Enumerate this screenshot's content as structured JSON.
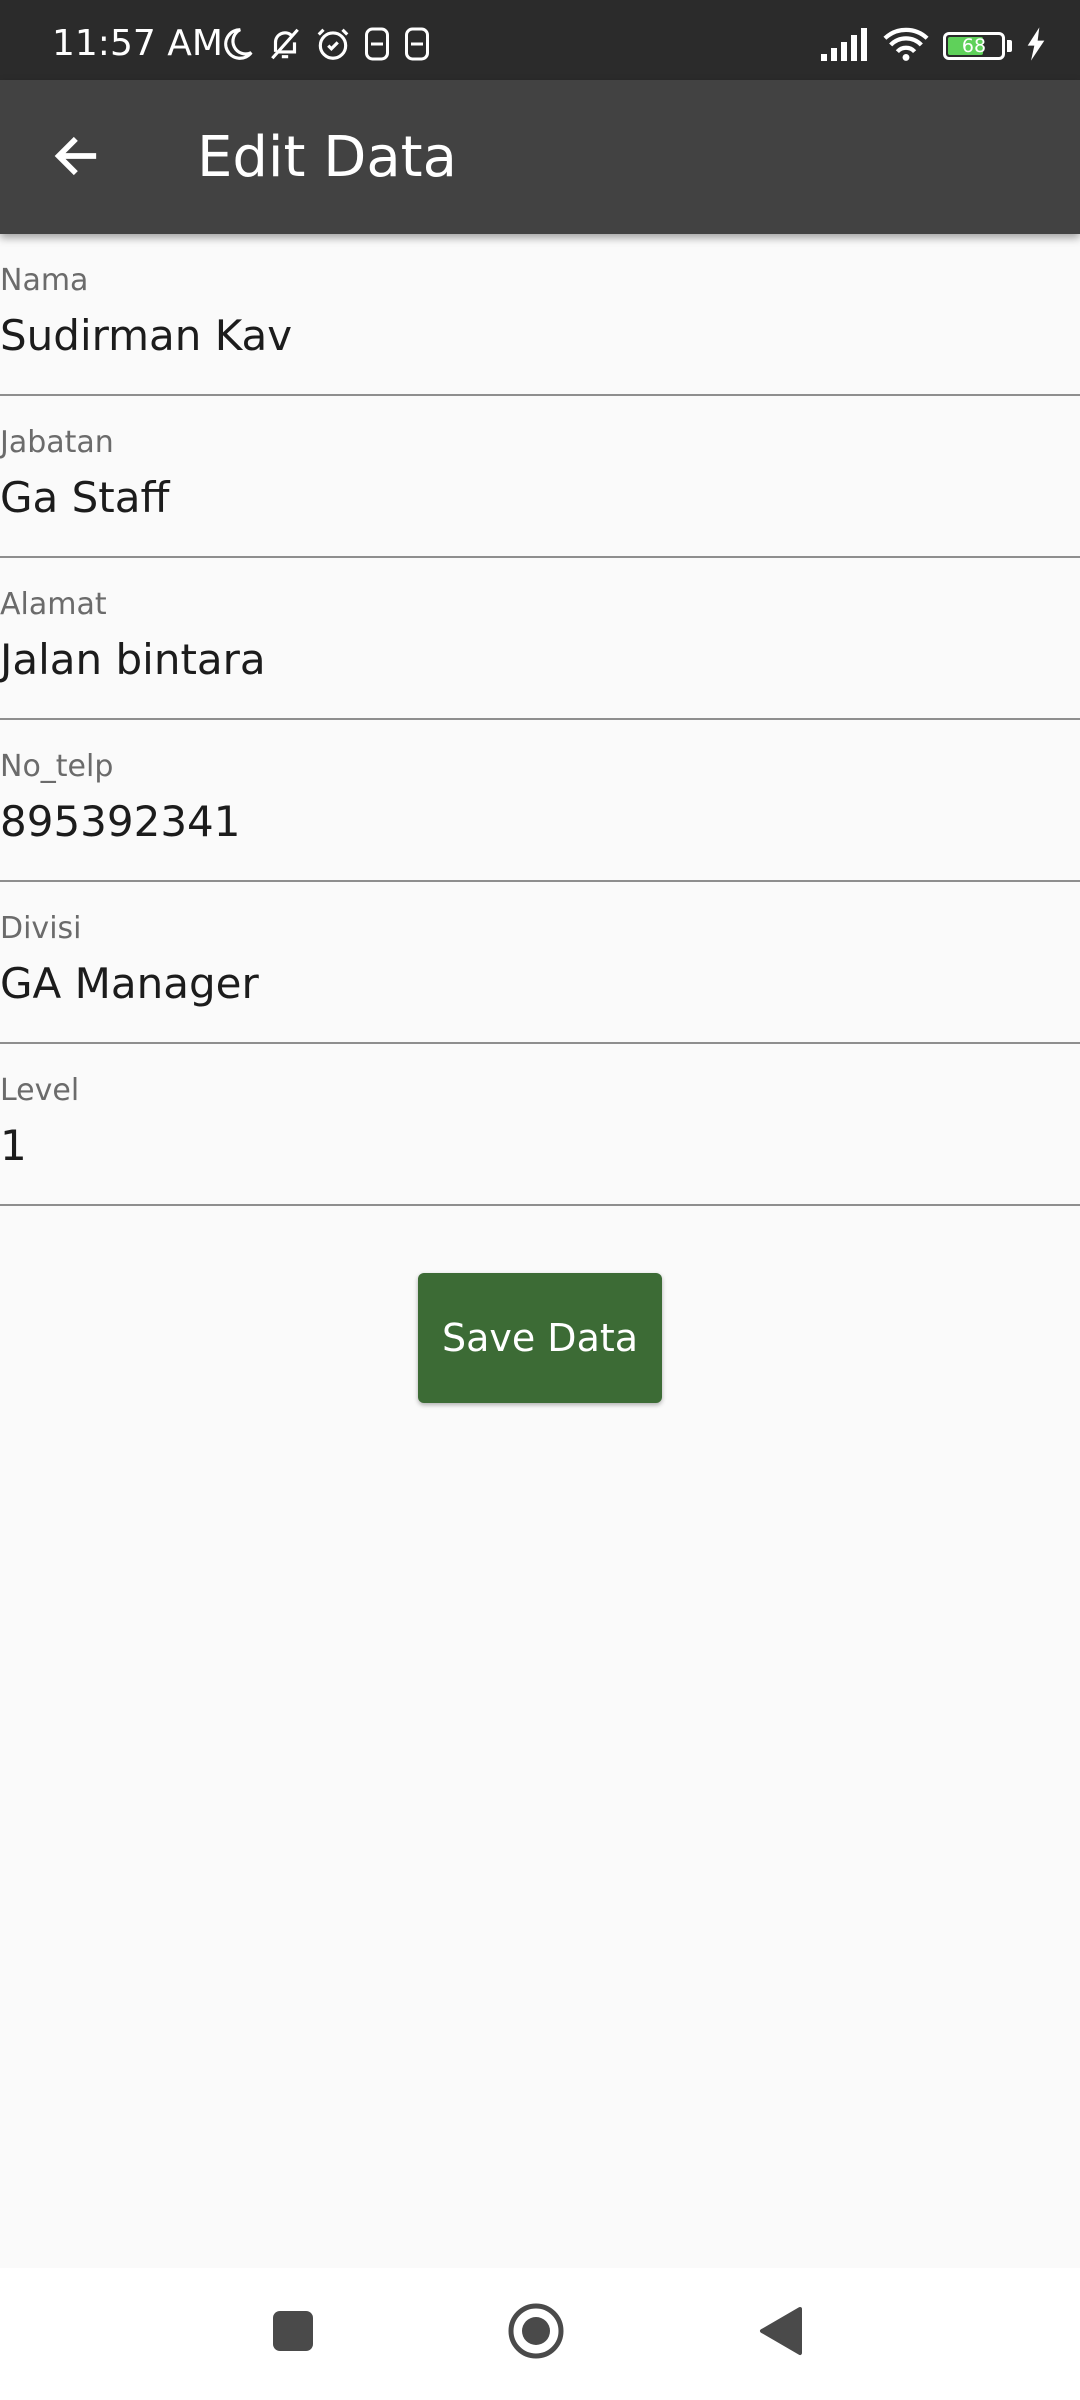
{
  "status_bar": {
    "time": "11:57 AM",
    "battery_level": "68",
    "battery_fraction": 0.68,
    "left_icons": [
      "moon-icon",
      "bell-off-icon",
      "alarm-icon",
      "sim-icon",
      "sim-icon"
    ],
    "right_icons": [
      "signal-icon",
      "wifi-icon",
      "battery-icon",
      "charging-icon"
    ]
  },
  "app_bar": {
    "title": "Edit Data",
    "back_icon": "arrow-left-icon",
    "background": "#424242"
  },
  "form": {
    "fields": [
      {
        "label": "Nama",
        "value": "Sudirman Kav"
      },
      {
        "label": "Jabatan",
        "value": "Ga Staff"
      },
      {
        "label": "Alamat",
        "value": "Jalan bintara"
      },
      {
        "label": "No_telp",
        "value": "895392341"
      },
      {
        "label": "Divisi",
        "value": "GA Manager"
      },
      {
        "label": "Level",
        "value": "1"
      }
    ]
  },
  "actions": {
    "save_label": "Save Data",
    "save_color": "#3c6b35"
  },
  "nav_bar": {
    "buttons": [
      "recents-square-icon",
      "home-circle-icon",
      "back-triangle-icon"
    ]
  }
}
